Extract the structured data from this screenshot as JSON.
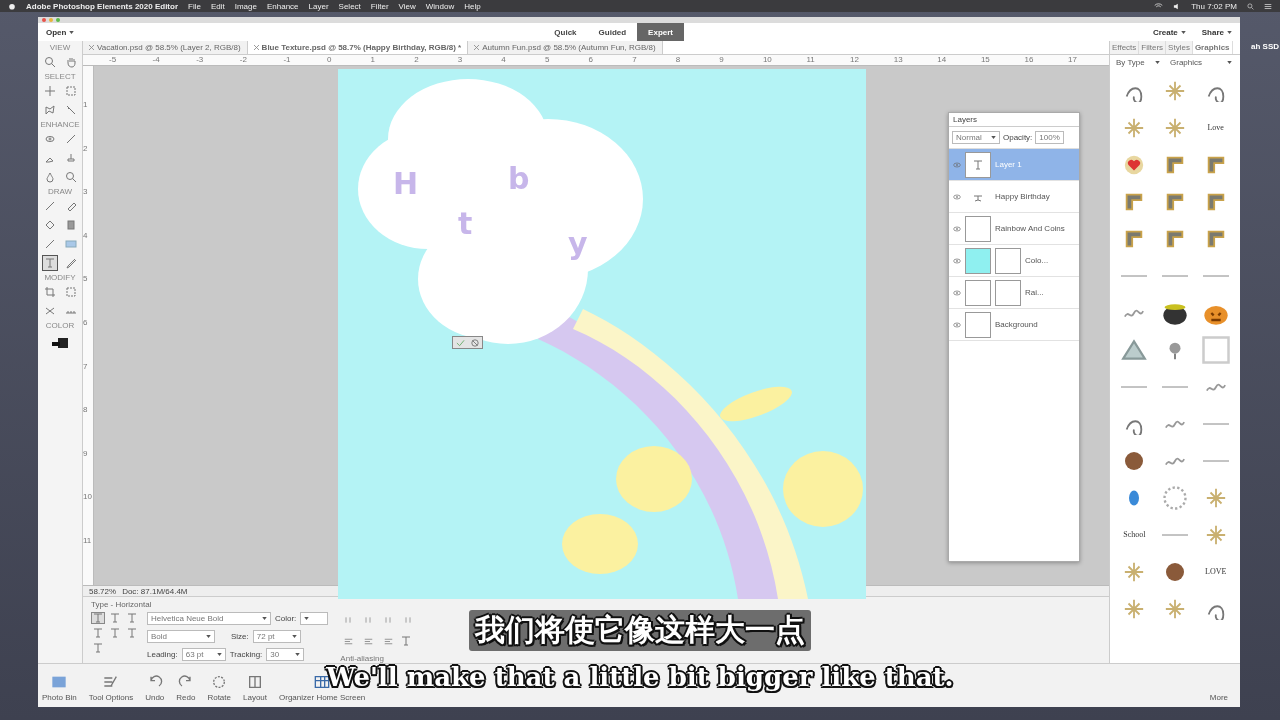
{
  "menubar": {
    "app": "Adobe Photoshop Elements 2020 Editor",
    "menus": [
      "File",
      "Edit",
      "Image",
      "Enhance",
      "Layer",
      "Select",
      "Filter",
      "View",
      "Window",
      "Help"
    ],
    "clock": "Thu 7:02 PM"
  },
  "desktop": {
    "drive_label": "ah SSD"
  },
  "header": {
    "open": "Open",
    "modes": [
      {
        "label": "Quick",
        "selected": false
      },
      {
        "label": "Guided",
        "selected": false
      },
      {
        "label": "Expert",
        "selected": true
      }
    ],
    "create": "Create",
    "share": "Share"
  },
  "doc_tabs": [
    {
      "label": "Vacation.psd @ 58.5% (Layer 2, RGB/8)",
      "selected": false
    },
    {
      "label": "Blue Texture.psd @ 58.7% (Happy Birthday, RGB/8) *",
      "selected": true
    },
    {
      "label": "Autumn Fun.psd @ 58.5% (Autumn Fun, RGB/8)",
      "selected": false
    }
  ],
  "ruler": {
    "horizontal": [
      "-5",
      "-4",
      "-3",
      "-2",
      "-1",
      "0",
      "1",
      "2",
      "3",
      "4",
      "5",
      "6",
      "7",
      "8",
      "9",
      "10",
      "11",
      "12",
      "13",
      "14",
      "15",
      "16",
      "17"
    ],
    "vertical": [
      "1",
      "2",
      "3",
      "4",
      "5",
      "6",
      "7",
      "8",
      "9",
      "10",
      "11"
    ]
  },
  "toolbox": [
    {
      "title": "VIEW",
      "tools": [
        {
          "kind": "zoom",
          "selected": false
        },
        {
          "kind": "hand",
          "selected": false
        }
      ]
    },
    {
      "title": "SELECT",
      "tools": [
        {
          "kind": "move",
          "selected": false
        },
        {
          "kind": "marquee",
          "selected": false
        },
        {
          "kind": "lasso",
          "selected": false
        },
        {
          "kind": "wand",
          "selected": false
        }
      ]
    },
    {
      "title": "ENHANCE",
      "tools": [
        {
          "kind": "eye",
          "selected": false
        },
        {
          "kind": "brush",
          "selected": false
        },
        {
          "kind": "sponge",
          "selected": false
        },
        {
          "kind": "stamp",
          "selected": false
        },
        {
          "kind": "blur",
          "selected": false
        },
        {
          "kind": "zoom",
          "selected": false
        }
      ]
    },
    {
      "title": "DRAW",
      "tools": [
        {
          "kind": "brush",
          "selected": false
        },
        {
          "kind": "eraser",
          "selected": false
        },
        {
          "kind": "bucket",
          "selected": false
        },
        {
          "kind": "gradient",
          "selected": false
        },
        {
          "kind": "dropper",
          "selected": false
        },
        {
          "kind": "rect",
          "selected": false
        },
        {
          "kind": "type",
          "selected": true
        },
        {
          "kind": "pencil",
          "selected": false
        }
      ]
    },
    {
      "title": "MODIFY",
      "tools": [
        {
          "kind": "crop",
          "selected": false
        },
        {
          "kind": "recompose",
          "selected": false
        },
        {
          "kind": "straighten",
          "selected": false
        },
        {
          "kind": "slice",
          "selected": false
        }
      ]
    },
    {
      "title": "COLOR"
    }
  ],
  "canvas": {
    "letters": [
      "H",
      "b",
      "t",
      "y"
    ]
  },
  "layers_panel": {
    "tab": "Layers",
    "blend": "Normal",
    "opacity_label": "Opacity:",
    "opacity": "100%",
    "layers": [
      {
        "name": "Layer 1",
        "kind": "text",
        "visible": true,
        "selected": true
      },
      {
        "name": "Happy Birthday",
        "kind": "warp",
        "visible": true,
        "selected": false
      },
      {
        "name": "Rainbow And Coins",
        "kind": "smart",
        "visible": true,
        "selected": false
      },
      {
        "name": "Colo...",
        "kind": "fill",
        "visible": true,
        "selected": false
      },
      {
        "name": "Rai...",
        "kind": "mask",
        "visible": true,
        "selected": false
      },
      {
        "name": "Background",
        "kind": "locked",
        "visible": true,
        "selected": false
      }
    ]
  },
  "right_panel": {
    "tabs": [
      {
        "label": "Effects",
        "selected": false
      },
      {
        "label": "Filters",
        "selected": false
      },
      {
        "label": "Styles",
        "selected": false
      },
      {
        "label": "Graphics",
        "selected": true
      }
    ],
    "by_type": "By Type",
    "category": "Graphics",
    "graphics": [
      {
        "kind": "swirl"
      },
      {
        "kind": "sparkle"
      },
      {
        "kind": "swirl"
      },
      {
        "kind": "sparkle"
      },
      {
        "kind": "sparkle"
      },
      {
        "kind": "tag",
        "label": "Love"
      },
      {
        "kind": "heart"
      },
      {
        "kind": "corner"
      },
      {
        "kind": "corner"
      },
      {
        "kind": "corner"
      },
      {
        "kind": "corner"
      },
      {
        "kind": "corner"
      },
      {
        "kind": "corner"
      },
      {
        "kind": "corner"
      },
      {
        "kind": "corner"
      },
      {
        "kind": "line"
      },
      {
        "kind": "line"
      },
      {
        "kind": "line"
      },
      {
        "kind": "scribble"
      },
      {
        "kind": "cauldron"
      },
      {
        "kind": "pumpkin"
      },
      {
        "kind": "tent"
      },
      {
        "kind": "flower"
      },
      {
        "kind": "frame"
      },
      {
        "kind": "line"
      },
      {
        "kind": "line"
      },
      {
        "kind": "scribble"
      },
      {
        "kind": "swirl"
      },
      {
        "kind": "scribble"
      },
      {
        "kind": "line"
      },
      {
        "kind": "cookie"
      },
      {
        "kind": "scribble"
      },
      {
        "kind": "line"
      },
      {
        "kind": "bean"
      },
      {
        "kind": "wreath"
      },
      {
        "kind": "sparkle"
      },
      {
        "kind": "tag",
        "label": "School"
      },
      {
        "kind": "line"
      },
      {
        "kind": "sparkle"
      },
      {
        "kind": "sparkle"
      },
      {
        "kind": "cookie"
      },
      {
        "kind": "tag",
        "label": "LOVE"
      },
      {
        "kind": "sparkle"
      },
      {
        "kind": "sparkle"
      },
      {
        "kind": "swirl"
      }
    ]
  },
  "status": {
    "zoom": "58.72%",
    "doc": "Doc: 87.1M/64.4M"
  },
  "options": {
    "title": "Type - Horizontal",
    "font": "Helvetica Neue Bold",
    "style": "Bold",
    "size_label": "Size:",
    "size": "72 pt",
    "leading_label": "Leading:",
    "leading": "63 pt",
    "tracking_label": "Tracking:",
    "tracking": "30",
    "color_label": "Color:",
    "anti_alias": "Anti-aliasing"
  },
  "taskbar": {
    "items": [
      {
        "label": "Photo Bin",
        "kind": "photo"
      },
      {
        "label": "Tool Options",
        "kind": "tools"
      },
      {
        "label": "Undo",
        "kind": "undo"
      },
      {
        "label": "Redo",
        "kind": "redo"
      },
      {
        "label": "Rotate",
        "kind": "rotate"
      },
      {
        "label": "Layout",
        "kind": "layout"
      },
      {
        "label": "Organizer Home Screen",
        "kind": "grid"
      }
    ],
    "more": "More"
  },
  "subtitles": [
    "我们将使它像这样大一点",
    "We'll make that a little bit bigger like that."
  ]
}
